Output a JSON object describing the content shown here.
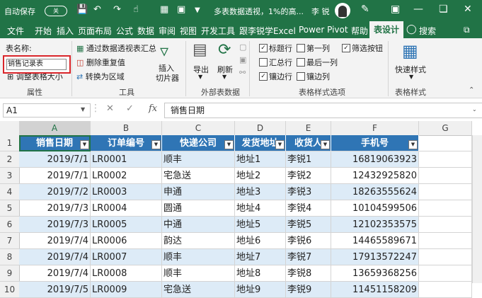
{
  "titlebar": {
    "autosave_label": "自动保存",
    "autosave_state": "关",
    "doc_title": "多表数据透视，1%的高...",
    "user_name": "李 锐"
  },
  "tabs": [
    "文件",
    "开始",
    "插入",
    "页面布局",
    "公式",
    "数据",
    "审阅",
    "视图",
    "开发工具",
    "跟李锐学Excel",
    "Power Pivot",
    "帮助",
    "表设计",
    "搜索"
  ],
  "ribbon": {
    "properties": {
      "table_name_label": "表名称:",
      "table_name_value": "销售记录表",
      "resize_label": "调整表格大小",
      "group_label": "属性"
    },
    "tools": {
      "pivot_label": "通过数据透视表汇总",
      "remove_dup_label": "删除重复值",
      "convert_label": "转换为区域",
      "slicer_label_1": "插入",
      "slicer_label_2": "切片器",
      "group_label": "工具"
    },
    "external": {
      "export_label": "导出",
      "refresh_label": "刷新",
      "group_label": "外部表数据"
    },
    "style_options": {
      "header_row": "标题行",
      "total_row": "汇总行",
      "banded_rows": "镶边行",
      "first_col": "第一列",
      "last_col": "最后一列",
      "banded_cols": "镶边列",
      "filter_btn": "筛选按钮",
      "group_label": "表格样式选项"
    },
    "styles": {
      "quick_styles_label": "快速样式",
      "group_label": "表格样式"
    }
  },
  "formula_bar": {
    "name_box": "A1",
    "formula": "销售日期"
  },
  "grid": {
    "columns": [
      "A",
      "B",
      "C",
      "D",
      "E",
      "F",
      "G"
    ],
    "rows": [
      "1",
      "2",
      "3",
      "4",
      "5",
      "6",
      "7",
      "8",
      "9",
      "10"
    ],
    "headers": [
      "销售日期",
      "订单编号",
      "快递公司",
      "发货地址",
      "收货人",
      "手机号"
    ],
    "data": [
      [
        "2019/7/1",
        "LR0001",
        "顺丰",
        "地址1",
        "李锐1",
        "16819063923"
      ],
      [
        "2019/7/1",
        "LR0002",
        "宅急送",
        "地址2",
        "李锐2",
        "12432925820"
      ],
      [
        "2019/7/2",
        "LR0003",
        "申通",
        "地址3",
        "李锐3",
        "18263555624"
      ],
      [
        "2019/7/3",
        "LR0004",
        "圆通",
        "地址4",
        "李锐4",
        "10104599506"
      ],
      [
        "2019/7/3",
        "LR0005",
        "中通",
        "地址5",
        "李锐5",
        "12102353575"
      ],
      [
        "2019/7/4",
        "LR0006",
        "韵达",
        "地址6",
        "李锐6",
        "14465589671"
      ],
      [
        "2019/7/4",
        "LR0007",
        "顺丰",
        "地址7",
        "李锐7",
        "17913572247"
      ],
      [
        "2019/7/4",
        "LR0008",
        "顺丰",
        "地址8",
        "李锐8",
        "13659368256"
      ],
      [
        "2019/7/5",
        "LR0009",
        "宅急送",
        "地址9",
        "李锐9",
        "11451158209"
      ]
    ]
  },
  "colors": {
    "excel_green": "#217346",
    "table_header": "#2f75b5",
    "band": "#ddebf7",
    "highlight_border": "#d9252a"
  }
}
